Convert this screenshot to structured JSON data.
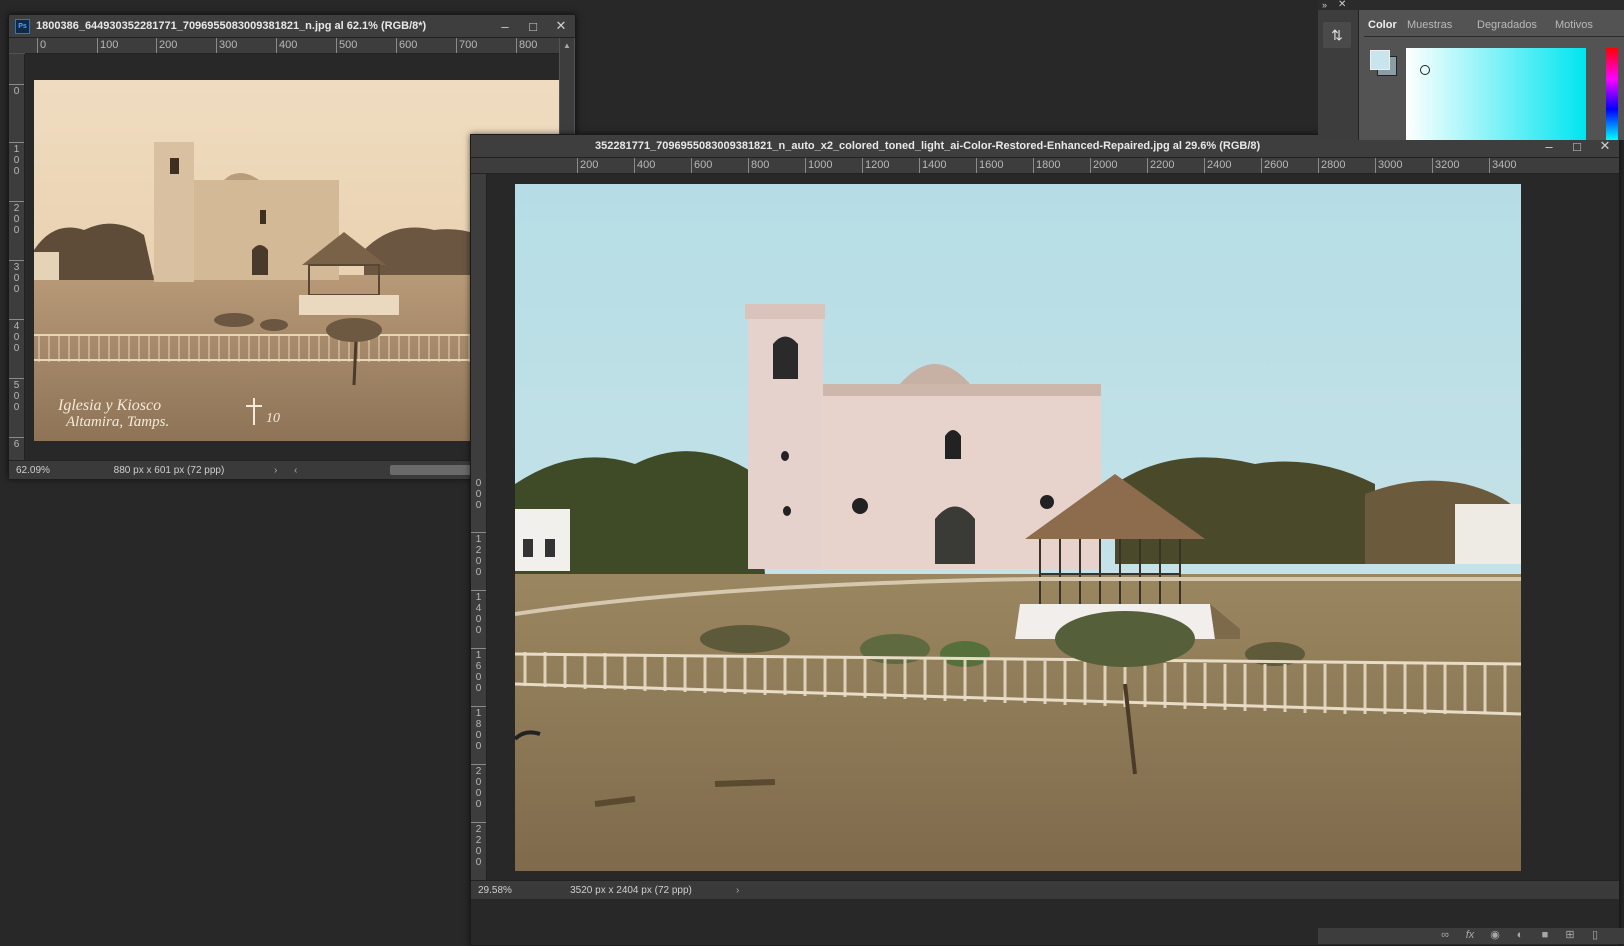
{
  "left_window": {
    "title": "1800386_644930352281771_7096955083009381821_n.jpg al 62.1% (RGB/8*)",
    "ruler_h": [
      "0",
      "100",
      "200",
      "300",
      "400",
      "500",
      "600",
      "700",
      "800"
    ],
    "ruler_v": [
      "0",
      "1\n0\n0",
      "2\n0\n0",
      "3\n0\n0",
      "4\n0\n0",
      "5\n0\n0",
      "6"
    ],
    "zoom": "62.09%",
    "doc_info": "880 px x 601 px (72 ppp)",
    "photo_caption_line1": "Iglesia y Kiosco",
    "photo_caption_line2": "Altamira, Tamps.",
    "photo_number": "10"
  },
  "right_window": {
    "title": "352281771_7096955083009381821_n_auto_x2_colored_toned_light_ai-Color-Restored-Enhanced-Repaired.jpg al 29.6% (RGB/8)",
    "ruler_h": [
      "200",
      "400",
      "600",
      "800",
      "1000",
      "1200",
      "1400",
      "1600",
      "1800",
      "2000",
      "2200",
      "2400",
      "2600",
      "2800",
      "3000",
      "3200",
      "3400"
    ],
    "ruler_v": [
      "0\n0\n0",
      "1\n2\n0\n0",
      "1\n4\n0\n0",
      "1\n6\n0\n0",
      "1\n8\n0\n0",
      "2\n0\n0\n0",
      "2\n2\n0\n0",
      "2"
    ],
    "zoom": "29.58%",
    "doc_info": "3520 px x 2404 px (72 ppp)"
  },
  "panel": {
    "tabs": [
      "Color",
      "Muestras",
      "Degradados",
      "Motivos"
    ],
    "active_tab": "Color",
    "picker_hue": "#00e5f0",
    "foreground_color": "#c8e4ec"
  },
  "icons": {
    "collapse": "double-chevron-icon",
    "close": "close-icon",
    "minimize": "minimize-icon",
    "maximize": "maximize-icon"
  }
}
